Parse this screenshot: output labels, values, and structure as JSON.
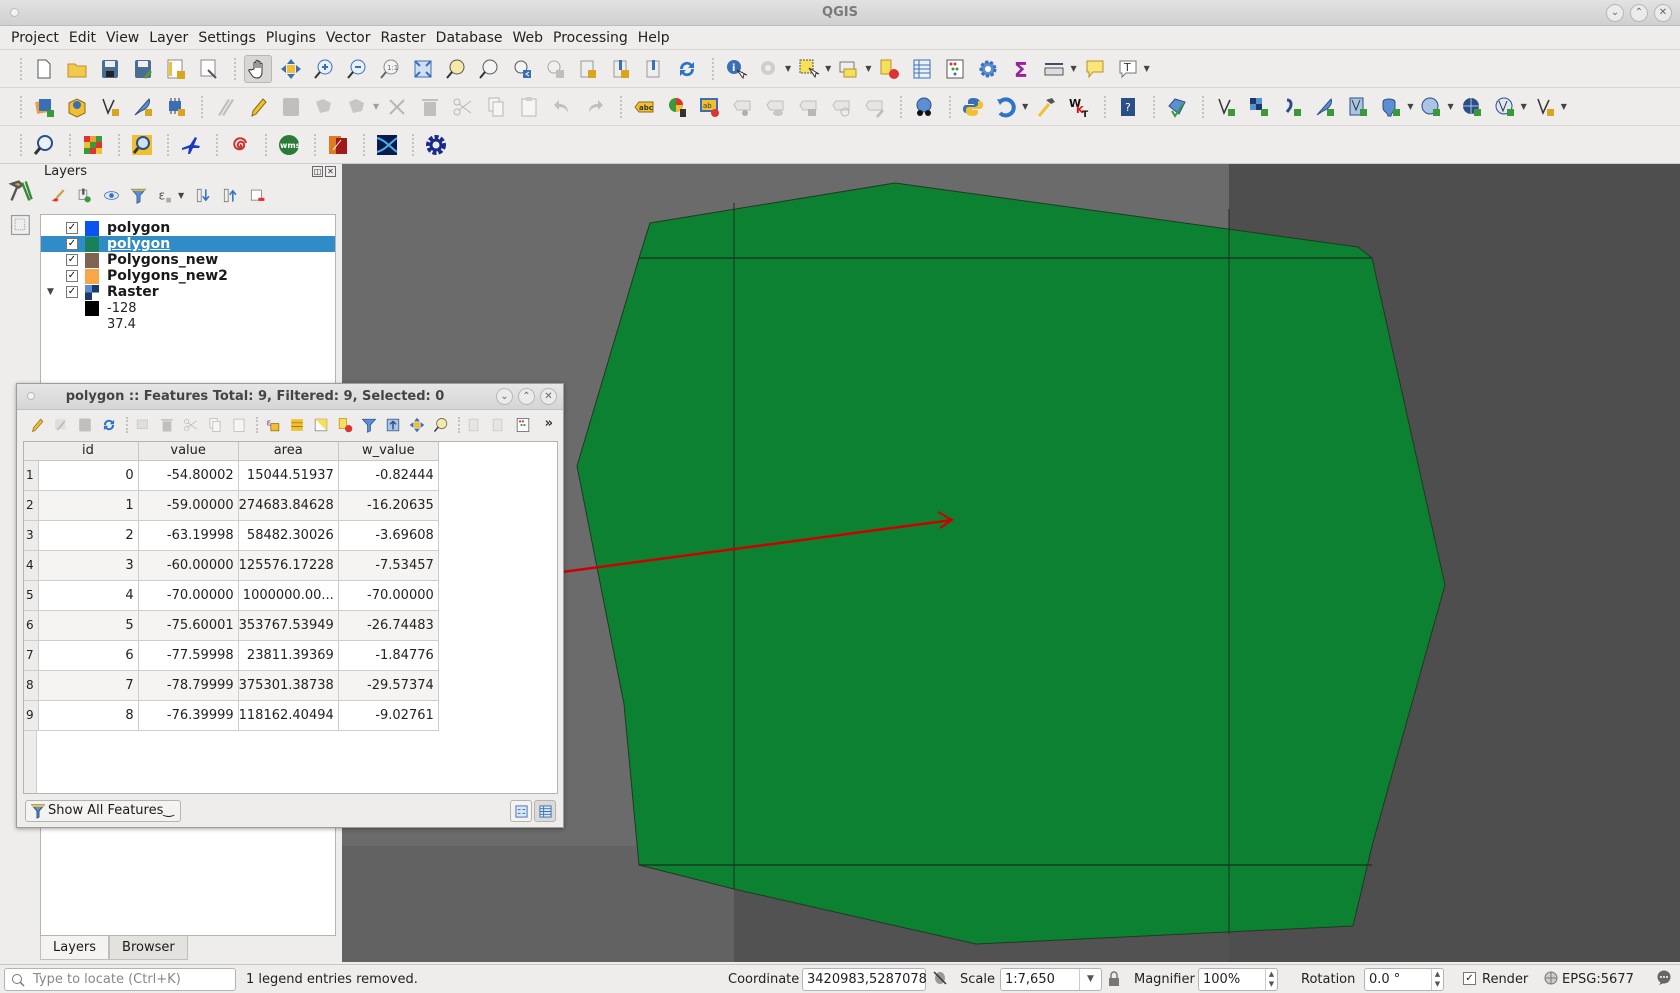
{
  "window": {
    "title": "QGIS",
    "controls": [
      "minimize",
      "maximize",
      "close"
    ]
  },
  "menubar": {
    "items": [
      "Project",
      "Edit",
      "View",
      "Layer",
      "Settings",
      "Plugins",
      "Vector",
      "Raster",
      "Database",
      "Web",
      "Processing",
      "Help"
    ]
  },
  "toolbars": {
    "row1": [
      "new-project",
      "open-project",
      "save-project",
      "save-as",
      "new-print-layout",
      "layout-manager",
      "pan",
      "pan-to-selection",
      "zoom-in",
      "zoom-out",
      "zoom-native",
      "zoom-full",
      "zoom-to-selection",
      "zoom-to-layer",
      "zoom-last",
      "zoom-next",
      "new-bookmark",
      "show-bookmarks",
      "spatial-bookmarks",
      "refresh",
      "identify",
      "run-action",
      "select-features",
      "select-by-value",
      "deselect",
      "attribute-table",
      "field-calculator",
      "toolbox",
      "statistics",
      "measure",
      "map-tips",
      "text-annotation"
    ],
    "row2": [
      "data-source-manager",
      "new-geopackage-layer",
      "new-shapefile-layer",
      "new-spatialite-layer",
      "new-virtual-layer",
      "current-edits",
      "toggle-editing",
      "save-edits",
      "add-polygon",
      "move-feature",
      "vertex-tool",
      "delete-selected",
      "cut",
      "copy",
      "paste",
      "undo",
      "redo",
      "label-tool",
      "diagram-tool",
      "pin-labels",
      "show-hide-labels",
      "move-label",
      "rotate-label",
      "change-label",
      "metasearch",
      "python-console",
      "processing-history",
      "build-virtual",
      "wkt",
      "help",
      "georeferencer",
      "add-vector-layer",
      "add-raster-layer",
      "add-delimited-text",
      "add-spatialite",
      "add-virtual",
      "add-postgis",
      "add-wms",
      "add-wcs",
      "add-wfs",
      "new-temporary-layer"
    ],
    "row3": [
      "plugin-search",
      "heatmap",
      "quick-finder",
      "flight-plugin",
      "spiral-plugin",
      "wms-plugin",
      "clip-plugin",
      "raster-plugin",
      "settings-plugin"
    ]
  },
  "layers_panel": {
    "title": "Layers",
    "layers": [
      {
        "name": "polygon",
        "checked": true,
        "color": "#0b52f2",
        "selected": false
      },
      {
        "name": "polygon",
        "checked": true,
        "color": "#1a8059",
        "selected": true
      },
      {
        "name": "Polygons_new",
        "checked": true,
        "color": "#7e6353",
        "selected": false
      },
      {
        "name": "Polygons_new2",
        "checked": true,
        "color": "#f9a746",
        "selected": false
      },
      {
        "name": "Raster",
        "checked": true,
        "color": "raster",
        "selected": false,
        "expanded": true
      }
    ],
    "raster_legend": {
      "min": "-128",
      "max": "37.4"
    },
    "tabs": [
      "Layers",
      "Browser"
    ],
    "active_tab": "Layers"
  },
  "attribute_table": {
    "title": "polygon :: Features Total: 9, Filtered: 9, Selected: 0",
    "columns": [
      "id",
      "value",
      "area",
      "w_value"
    ],
    "rows": [
      [
        "1",
        "0",
        "-54.80002",
        "15044.51937",
        "-0.82444"
      ],
      [
        "2",
        "1",
        "-59.00000",
        "274683.84628",
        "-16.20635"
      ],
      [
        "3",
        "2",
        "-63.19998",
        "58482.30026",
        "-3.69608"
      ],
      [
        "4",
        "3",
        "-60.00000",
        "125576.17228",
        "-7.53457"
      ],
      [
        "5",
        "4",
        "-70.00000",
        "1000000.00...",
        "-70.00000"
      ],
      [
        "6",
        "5",
        "-75.60001",
        "353767.53949",
        "-26.74483"
      ],
      [
        "7",
        "6",
        "-77.59998",
        "23811.39369",
        "-1.84776"
      ],
      [
        "8",
        "7",
        "-78.79999",
        "375301.38738",
        "-29.57374"
      ],
      [
        "9",
        "8",
        "-76.39999",
        "118162.40494",
        "-9.02761"
      ]
    ],
    "filter_button": "Show All Features",
    "more_label": "»"
  },
  "map": {
    "polygon_fill": "#0d8132",
    "annotation_arrow_color": "#cc0000",
    "background_cells": [
      "#6a6a6a",
      "#5b5b5b",
      "#4e4e4e"
    ]
  },
  "statusbar": {
    "locator_placeholder": "Type to locate (Ctrl+K)",
    "message": "1 legend entries removed.",
    "coordinate_label": "Coordinate",
    "coordinate_value": "3420983,5287078",
    "scale_label": "Scale",
    "scale_value": "1:7,650",
    "magnifier_label": "Magnifier",
    "magnifier_value": "100%",
    "rotation_label": "Rotation",
    "rotation_value": "0.0 °",
    "render_label": "Render",
    "render_checked": true,
    "crs": "EPSG:5677"
  }
}
